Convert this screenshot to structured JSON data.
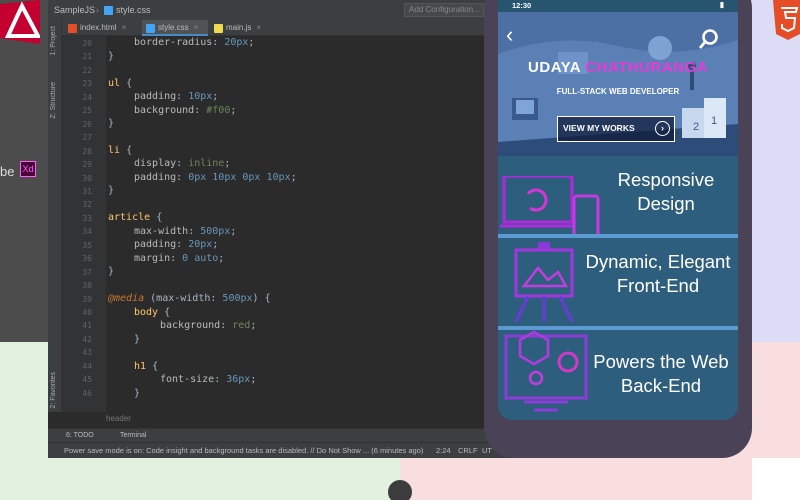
{
  "colors": {
    "ide_bg": "#2b2b2b",
    "selector": "#ffc66d",
    "string": "#6a8759",
    "number": "#6897bb",
    "keyword": "#cc7832",
    "accent_pink": "#e83bd9",
    "phone_bg": "#27546e"
  },
  "slide_left": {
    "adobe_text": "be",
    "xd_label": "Xd"
  },
  "ide": {
    "project_name": "SampleJS",
    "current_file": "style.css",
    "add_configuration": "Add Configuration...",
    "left_tabs": [
      "1: Project",
      "Z: Structure",
      "2: Favorites"
    ],
    "tabs": [
      {
        "label": "index.html",
        "close": "×",
        "icon_color": "#e44d26"
      },
      {
        "label": "style.css",
        "close": "×",
        "icon_color": "#42a5f5"
      },
      {
        "label": "main.js",
        "close": "×",
        "icon_color": "#f0db4f"
      }
    ],
    "line_numbers": [
      "20",
      "21",
      "22",
      "23",
      "24",
      "25",
      "26",
      "27",
      "28",
      "29",
      "30",
      "31",
      "32",
      "33",
      "34",
      "35",
      "36",
      "37",
      "38",
      "39",
      "40",
      "41",
      "42",
      "43",
      "44",
      "45",
      "46"
    ],
    "code": {
      "l20_prop": "border-radius",
      "l20_val": "20px",
      "l21": "}",
      "l23_sel": "ul",
      "l23_brace": "{",
      "l24_prop": "padding",
      "l24_val": "10px",
      "l25_prop": "background",
      "l25_val": "#f00",
      "l26": "}",
      "l28_sel": "li",
      "l28_brace": "{",
      "l29_prop": "display",
      "l29_val": "inline",
      "l30_prop": "padding",
      "l30_val": "0px 10px 0px 10px",
      "l31": "}",
      "l33_sel": "article",
      "l33_brace": "{",
      "l34_prop": "max-width",
      "l34_val": "500px",
      "l35_prop": "padding",
      "l35_val": "20px",
      "l36_prop": "margin",
      "l36_val": "0 auto",
      "l37": "}",
      "l39_at": "@media",
      "l39_rest": "(max-width:",
      "l39_num": "500px",
      "l39_end": ") {",
      "l40_sel": "body",
      "l40_brace": "{",
      "l41_prop": "background",
      "l41_val": "red",
      "l42": "}",
      "l44_sel": "h1",
      "l44_brace": "{",
      "l45_prop": "font-size",
      "l45_val": "36px",
      "l46": "}"
    },
    "breadcrumb": "header",
    "bottom_tools": {
      "todo": "6: TODO",
      "terminal": "Terminal"
    },
    "status": {
      "message": "Power save mode is on: Code insight and background tasks are disabled. // Do Not Show ... (6 minutes ago)",
      "position": "2:24",
      "line_ending": "CRLF",
      "encoding": "UT"
    }
  },
  "phone": {
    "time": "12:30",
    "status_right": "▮",
    "hero": {
      "name_first": "UDAYA",
      "name_last": "CHATHURANGA",
      "subtitle": "FULL-STACK WEB DEVELOPER",
      "button": "VIEW MY WORKS",
      "button_arrow": "›",
      "back": "‹"
    },
    "features": [
      {
        "line1": "Responsive",
        "line2": "Design",
        "icon": "laptop-phone-sync-icon"
      },
      {
        "line1": "Dynamic, Elegant",
        "line2": "Front-End",
        "icon": "easel-chart-icon"
      },
      {
        "line1": "Powers the Web",
        "line2": "Back-End",
        "icon": "gears-monitor-icon"
      }
    ]
  }
}
